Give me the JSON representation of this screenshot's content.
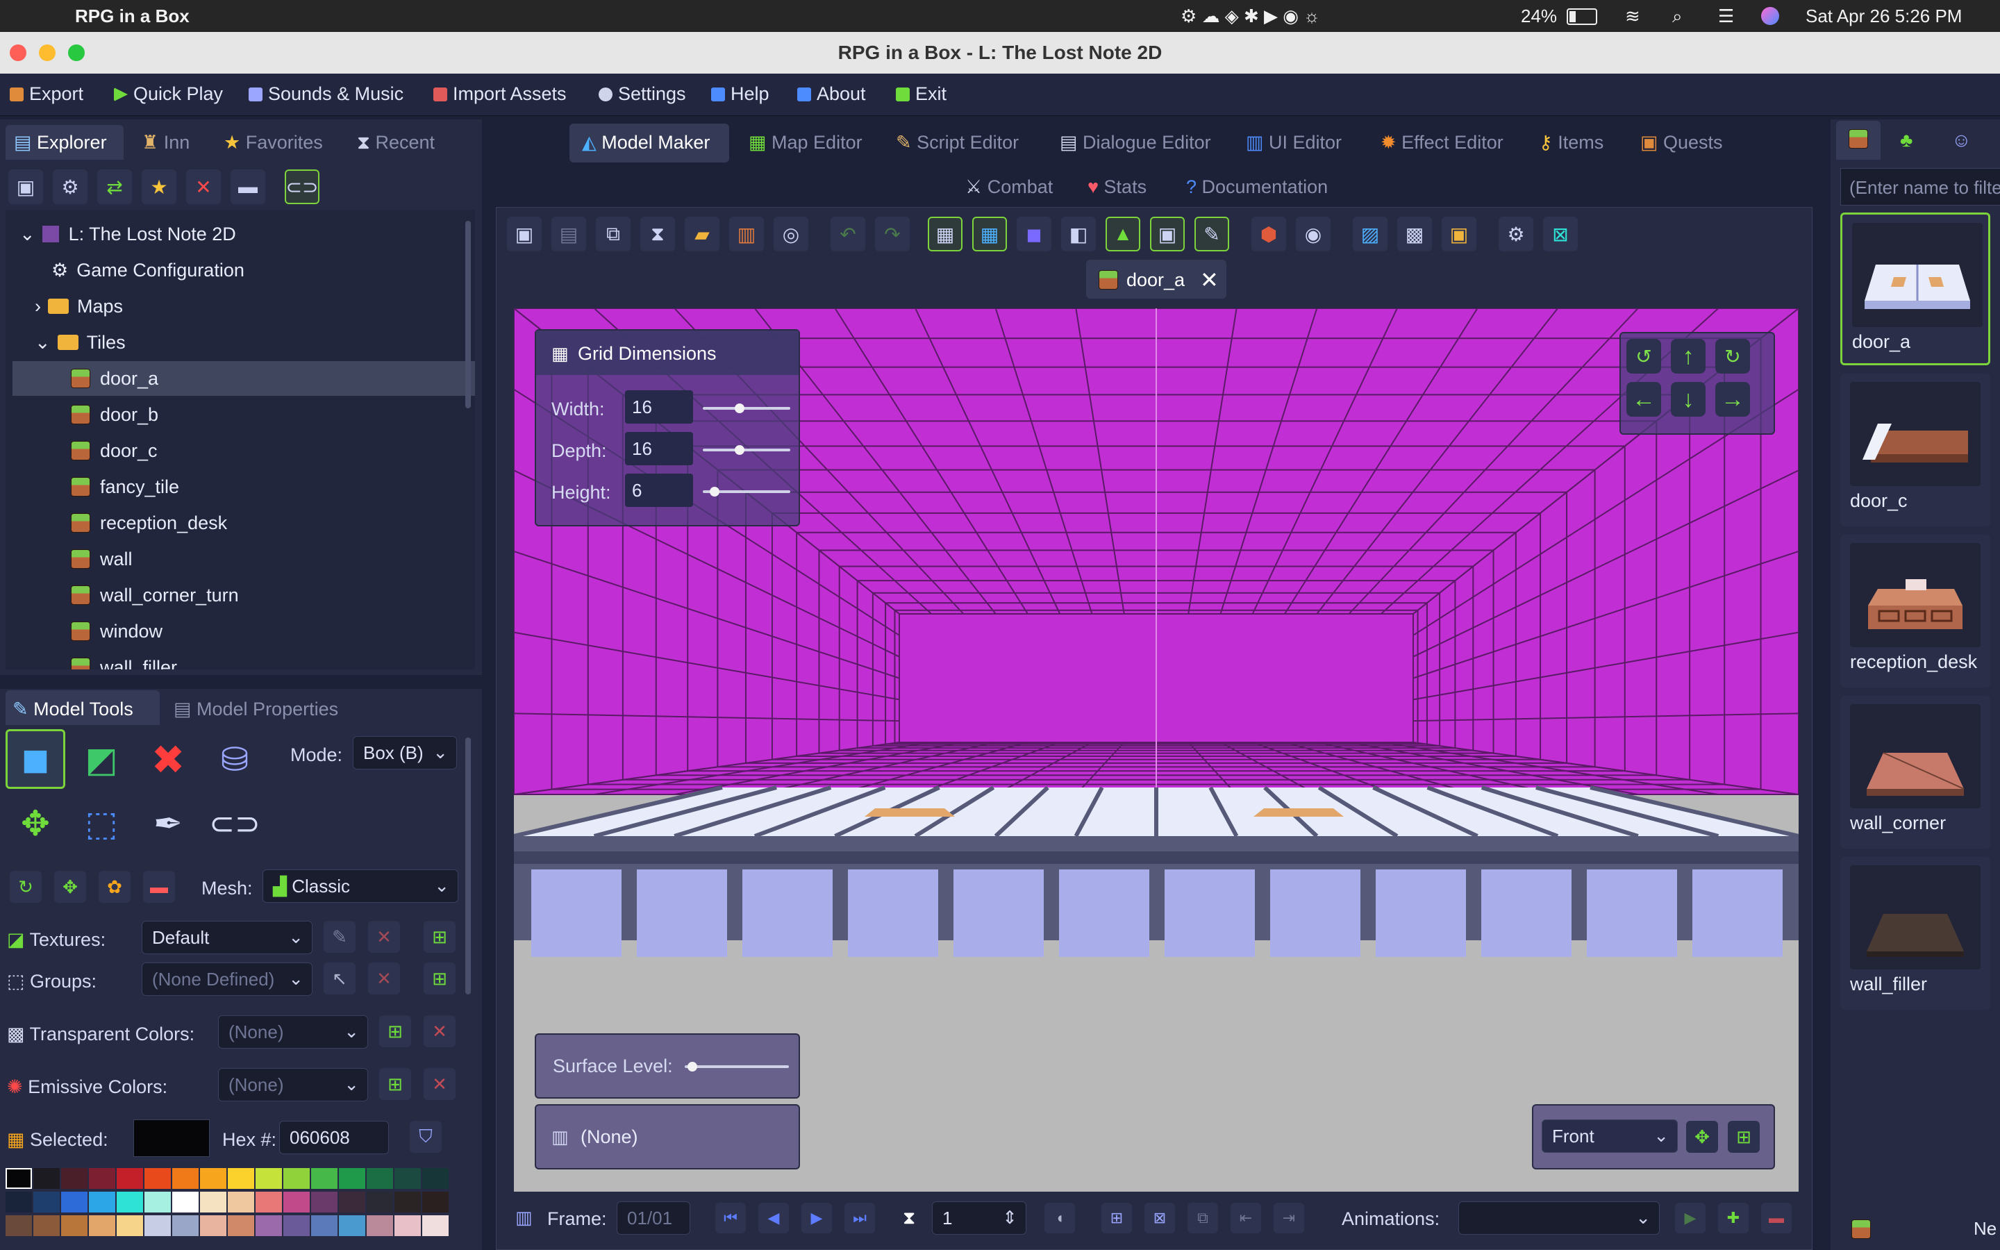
{
  "menubar": {
    "app_name": "RPG in a Box",
    "battery": "24%",
    "datetime": "Sat Apr 26  5:26 PM"
  },
  "window": {
    "title": "RPG in a Box - L: The Lost Note 2D"
  },
  "app_menu": [
    {
      "label": "Export",
      "icon": "export-icon",
      "color": "#e08a3c"
    },
    {
      "label": "Quick Play",
      "icon": "play-icon",
      "color": "#6fdc3c"
    },
    {
      "label": "Sounds & Music",
      "icon": "speaker-icon",
      "color": "#9aa6ff"
    },
    {
      "label": "Import Assets",
      "icon": "import-icon",
      "color": "#e05a5a"
    },
    {
      "label": "Settings",
      "icon": "gear-icon",
      "color": "#d0d4ea"
    },
    {
      "label": "Help",
      "icon": "help-icon",
      "color": "#4d8cff"
    },
    {
      "label": "About",
      "icon": "info-icon",
      "color": "#4d8cff"
    },
    {
      "label": "Exit",
      "icon": "exit-icon",
      "color": "#6fdc3c"
    }
  ],
  "left_tabs": [
    "Explorer",
    "Inn",
    "Favorites",
    "Recent"
  ],
  "explorer": {
    "project": "L: The Lost Note 2D",
    "game_config": "Game Configuration",
    "maps": "Maps",
    "tiles": "Tiles",
    "tile_items": [
      "door_a",
      "door_b",
      "door_c",
      "fancy_tile",
      "reception_desk",
      "wall",
      "wall_corner_turn",
      "window",
      "wall_filler"
    ],
    "selected": "door_a"
  },
  "tool_tabs": [
    "Model Tools",
    "Model Properties"
  ],
  "model_tools": {
    "mode_label": "Mode:",
    "mode_value": "Box (B)",
    "mesh_label": "Mesh:",
    "mesh_value": "Classic",
    "textures_label": "Textures:",
    "textures_value": "Default",
    "groups_label": "Groups:",
    "groups_value": "(None Defined)",
    "transparent_label": "Transparent Colors:",
    "transparent_value": "(None)",
    "emissive_label": "Emissive Colors:",
    "emissive_value": "(None)",
    "selected_label": "Selected:",
    "hex_label": "Hex #:",
    "hex_value": "060608"
  },
  "palette_row1": [
    "#060608",
    "#1c1b22",
    "#4a1f2a",
    "#7c1f30",
    "#c4202a",
    "#e84a1c",
    "#f07a18",
    "#f7a51c",
    "#fbd22c",
    "#c5e23a",
    "#8fd23a",
    "#46b84a",
    "#1e9a4a",
    "#1b6e44"
  ],
  "palette_row2": [
    "#19243a",
    "#1e3e6e",
    "#2d6bd8",
    "#2ca6e6",
    "#2ee2d6",
    "#a6f0e2",
    "#ffffff",
    "#f5e2c0",
    "#f0c8a0",
    "#e87878",
    "#c04a8a",
    "#6a3a6a",
    "#3a2a3a",
    "#2a2020"
  ],
  "editor_tabs_row1": [
    {
      "label": "Model Maker",
      "color": "#4db0ff"
    },
    {
      "label": "Map Editor",
      "color": "#6fdc3c"
    },
    {
      "label": "Script Editor",
      "color": "#e2b46a"
    },
    {
      "label": "Dialogue Editor",
      "color": "#d0d4ea"
    },
    {
      "label": "UI Editor",
      "color": "#4d8cff"
    },
    {
      "label": "Effect Editor",
      "color": "#f28c2c"
    },
    {
      "label": "Items",
      "color": "#f7c43c"
    },
    {
      "label": "Quests",
      "color": "#e08a3c"
    }
  ],
  "editor_tabs_row2": [
    {
      "label": "Combat",
      "color": "#c8cde6"
    },
    {
      "label": "Stats",
      "color": "#ff5a6a"
    },
    {
      "label": "Documentation",
      "color": "#4d8cff"
    }
  ],
  "open_file": "door_a",
  "grid": {
    "title": "Grid Dimensions",
    "width_label": "Width:",
    "width": "16",
    "depth_label": "Depth:",
    "depth": "16",
    "height_label": "Height:",
    "height": "6"
  },
  "surface_label": "Surface Level:",
  "layer_value": "(None)",
  "view_value": "Front",
  "frame": {
    "label": "Frame:",
    "value": "01/01",
    "speed": "1",
    "animations_label": "Animations:"
  },
  "right_panel": {
    "search_placeholder": "(Enter name to filter)",
    "thumbs": [
      "door_a",
      "door_c",
      "reception_desk",
      "wall_corner",
      "wall_filler"
    ],
    "bottom_text": "Ne"
  }
}
